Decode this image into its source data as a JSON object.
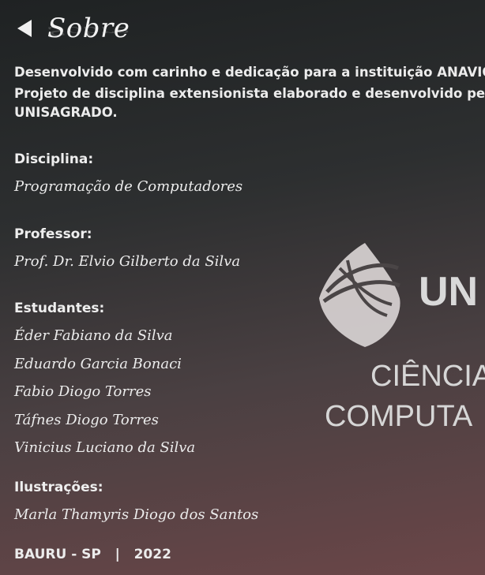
{
  "header": {
    "title": "Sobre"
  },
  "intro": {
    "line1_prefix": "Desenvolvido com carinho e dedicação para a instituição ",
    "line1_bold": "ANAVIQ",
    "line1_suffix": ".",
    "line2": "Projeto de disciplina extensionista elaborado e desenvolvido pelos e",
    "line3": "UNISAGRADO."
  },
  "sections": {
    "disciplina": {
      "heading": "Disciplina:",
      "value": "Programação de Computadores"
    },
    "professor": {
      "heading": "Professor:",
      "value": "Prof. Dr. Elvio Gilberto da Silva"
    },
    "estudantes": {
      "heading": "Estudantes:",
      "names": [
        "Éder Fabiano da Silva",
        "Eduardo Garcia Bonaci",
        "Fabio Diogo Torres",
        "Táfnes Diogo Torres",
        "Vinicius Luciano da Silva"
      ]
    },
    "ilustracoes": {
      "heading": "Ilustrações:",
      "value": "Marla Thamyris Diogo dos Santos"
    }
  },
  "logo": {
    "brand": "UN",
    "line1": "CIÊNCIA",
    "line2": "COMPUTA"
  },
  "footer": {
    "text": "BAURU - SP   |   2022"
  },
  "colors": {
    "text": "#ececec",
    "logo": "#d6d6d6"
  }
}
